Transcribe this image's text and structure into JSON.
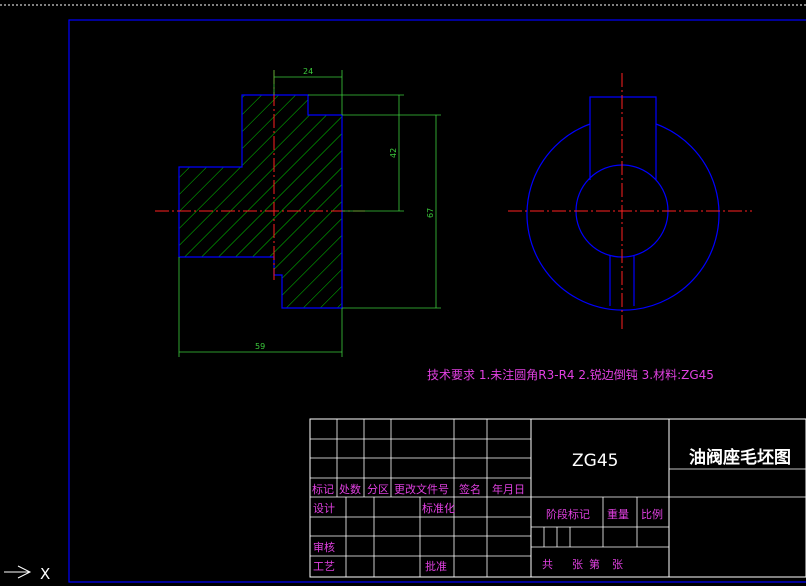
{
  "dimensions": {
    "top_width": "24",
    "upper_height": "42",
    "total_height": "67",
    "total_width": "59"
  },
  "technical_note": "技术要求 1.未注圆角R3-R4 2.锐边倒钝 3.材料:ZG45",
  "title_block": {
    "material": "ZG45",
    "drawing_title": "油阀座毛坯图",
    "rev_headers": [
      "标记",
      "处数",
      "分区",
      "更改文件号",
      "签名",
      "年月日"
    ],
    "design": "设计",
    "standardization": "标准化",
    "stage_mark": "阶段标记",
    "weight": "重量",
    "scale": "比例",
    "review": "审核",
    "process": "工艺",
    "approve": "批准",
    "sheet_total": "共",
    "sheet_unit": "张",
    "sheet_no": "第",
    "sheet_unit2": "张"
  },
  "ucs_axis_label": "X",
  "colors": {
    "background": "#000000",
    "outline": "#0000ff",
    "hatch": "#00ff00",
    "dimension": "#3ccc3c",
    "centerline": "#ff2020",
    "annotation": "#e040e0",
    "table": "#ffffff"
  }
}
